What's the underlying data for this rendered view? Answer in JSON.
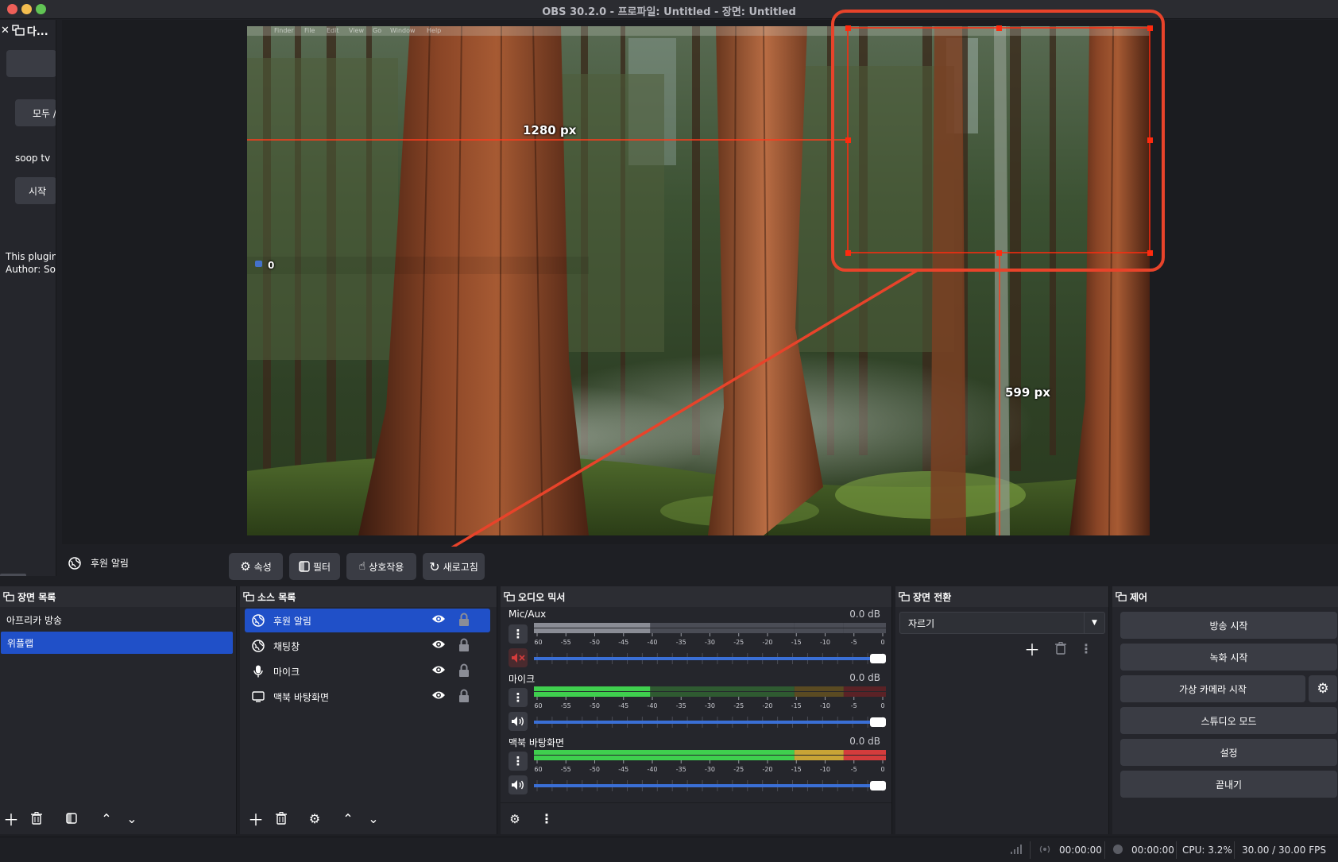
{
  "window": {
    "title": "OBS 30.2.0 - 프로파일: Untitled - 장면: Untitled"
  },
  "left_dock": {
    "title": "다...",
    "button_all": "모두 /",
    "label_soop": "soop tv",
    "button_start": "시작",
    "plugin_line1": "This plugin",
    "plugin_line2": "Author: Sor"
  },
  "preview": {
    "measure_width": "1280 px",
    "measure_height": "599 px",
    "widget_count": "0",
    "embedded_menu": [
      "Finder",
      "File",
      "Edit",
      "View",
      "Go",
      "Window",
      "Help"
    ]
  },
  "source_toolbar": {
    "selected_source": "후원 알림",
    "properties_label": "속성",
    "filters_label": "필터",
    "interact_label": "상호작용",
    "refresh_label": "새로고침"
  },
  "scenes": {
    "title": "장면 목록",
    "items": [
      "아프리카 방송",
      "위플랩"
    ],
    "active_index": 1
  },
  "sources": {
    "title": "소스 목록",
    "items": [
      {
        "name": "후원 알림",
        "icon": "globe-icon"
      },
      {
        "name": "채팅창",
        "icon": "globe-icon"
      },
      {
        "name": "마이크",
        "icon": "microphone-icon"
      },
      {
        "name": "맥북 바탕화면",
        "icon": "monitor-icon"
      }
    ],
    "active_index": 0
  },
  "mixer": {
    "title": "오디오 믹서",
    "scale": [
      "-60",
      "-55",
      "-50",
      "-45",
      "-40",
      "-35",
      "-30",
      "-25",
      "-20",
      "-15",
      "-10",
      "-5",
      "0"
    ],
    "channels": [
      {
        "name": "Mic/Aux",
        "db": "0.0 dB",
        "muted": true,
        "level": 0.33,
        "volume": 1.0
      },
      {
        "name": "마이크",
        "db": "0.0 dB",
        "muted": false,
        "level": 0.33,
        "volume": 1.0
      },
      {
        "name": "맥북 바탕화면",
        "db": "0.0 dB",
        "muted": false,
        "level": 1.0,
        "volume": 1.0
      }
    ]
  },
  "transitions": {
    "title": "장면 전환",
    "selected": "자르기"
  },
  "controls": {
    "title": "제어",
    "start_stream": "방송 시작",
    "start_record": "녹화 시작",
    "start_virtualcam": "가상 카메라 시작",
    "studio_mode": "스튜디오 모드",
    "settings": "설정",
    "exit": "끝내기"
  },
  "status": {
    "stream_time": "00:00:00",
    "record_time": "00:00:00",
    "cpu": "CPU: 3.2%",
    "fps": "30.00 / 30.00 FPS"
  },
  "colors": {
    "accent": "#2050c8",
    "annotation": "#e8432a",
    "meter_green": "#3fcf4e",
    "meter_yellow": "#c8a436",
    "meter_red": "#d43c3c",
    "slider_blue": "#3a6fd6"
  }
}
